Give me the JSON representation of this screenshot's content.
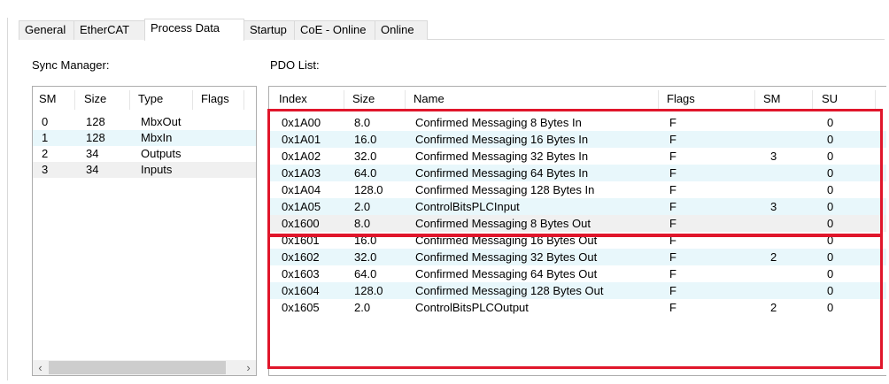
{
  "tabs": [
    {
      "label": "General"
    },
    {
      "label": "EtherCAT"
    },
    {
      "label": "Process Data"
    },
    {
      "label": "Startup"
    },
    {
      "label": "CoE - Online"
    },
    {
      "label": "Online"
    }
  ],
  "active_tab": "Process Data",
  "sync_manager": {
    "label": "Sync Manager:",
    "columns": [
      "SM",
      "Size",
      "Type",
      "Flags"
    ],
    "rows": [
      {
        "sm": "0",
        "size": "128",
        "type": "MbxOut",
        "flags": ""
      },
      {
        "sm": "1",
        "size": "128",
        "type": "MbxIn",
        "flags": ""
      },
      {
        "sm": "2",
        "size": "34",
        "type": "Outputs",
        "flags": ""
      },
      {
        "sm": "3",
        "size": "34",
        "type": "Inputs",
        "flags": ""
      }
    ],
    "scroll_left": "‹",
    "scroll_right": "›"
  },
  "pdo_list": {
    "label": "PDO List:",
    "columns": [
      "Index",
      "Size",
      "Name",
      "Flags",
      "SM",
      "SU"
    ],
    "rows": [
      {
        "index": "0x1A00",
        "size": "8.0",
        "name": "Confirmed Messaging 8 Bytes In",
        "flags": "F",
        "sm": "",
        "su": "0"
      },
      {
        "index": "0x1A01",
        "size": "16.0",
        "name": "Confirmed Messaging 16 Bytes In",
        "flags": "F",
        "sm": "",
        "su": "0"
      },
      {
        "index": "0x1A02",
        "size": "32.0",
        "name": "Confirmed Messaging 32 Bytes In",
        "flags": "F",
        "sm": "3",
        "su": "0"
      },
      {
        "index": "0x1A03",
        "size": "64.0",
        "name": "Confirmed Messaging 64 Bytes In",
        "flags": "F",
        "sm": "",
        "su": "0"
      },
      {
        "index": "0x1A04",
        "size": "128.0",
        "name": "Confirmed Messaging 128 Bytes In",
        "flags": "F",
        "sm": "",
        "su": "0"
      },
      {
        "index": "0x1A05",
        "size": "2.0",
        "name": "ControlBitsPLCInput",
        "flags": "F",
        "sm": "3",
        "su": "0"
      },
      {
        "index": "0x1600",
        "size": "8.0",
        "name": "Confirmed Messaging 8 Bytes Out",
        "flags": "F",
        "sm": "",
        "su": "0"
      },
      {
        "index": "0x1601",
        "size": "16.0",
        "name": "Confirmed Messaging 16 Bytes Out",
        "flags": "F",
        "sm": "",
        "su": "0"
      },
      {
        "index": "0x1602",
        "size": "32.0",
        "name": "Confirmed Messaging 32 Bytes Out",
        "flags": "F",
        "sm": "2",
        "su": "0"
      },
      {
        "index": "0x1603",
        "size": "64.0",
        "name": "Confirmed Messaging 64 Bytes Out",
        "flags": "F",
        "sm": "",
        "su": "0"
      },
      {
        "index": "0x1604",
        "size": "128.0",
        "name": "Confirmed Messaging 128 Bytes Out",
        "flags": "F",
        "sm": "",
        "su": "0"
      },
      {
        "index": "0x1605",
        "size": "2.0",
        "name": "ControlBitsPLCOutput",
        "flags": "F",
        "sm": "2",
        "su": "0"
      }
    ]
  },
  "highlight_color": "#e0162b"
}
